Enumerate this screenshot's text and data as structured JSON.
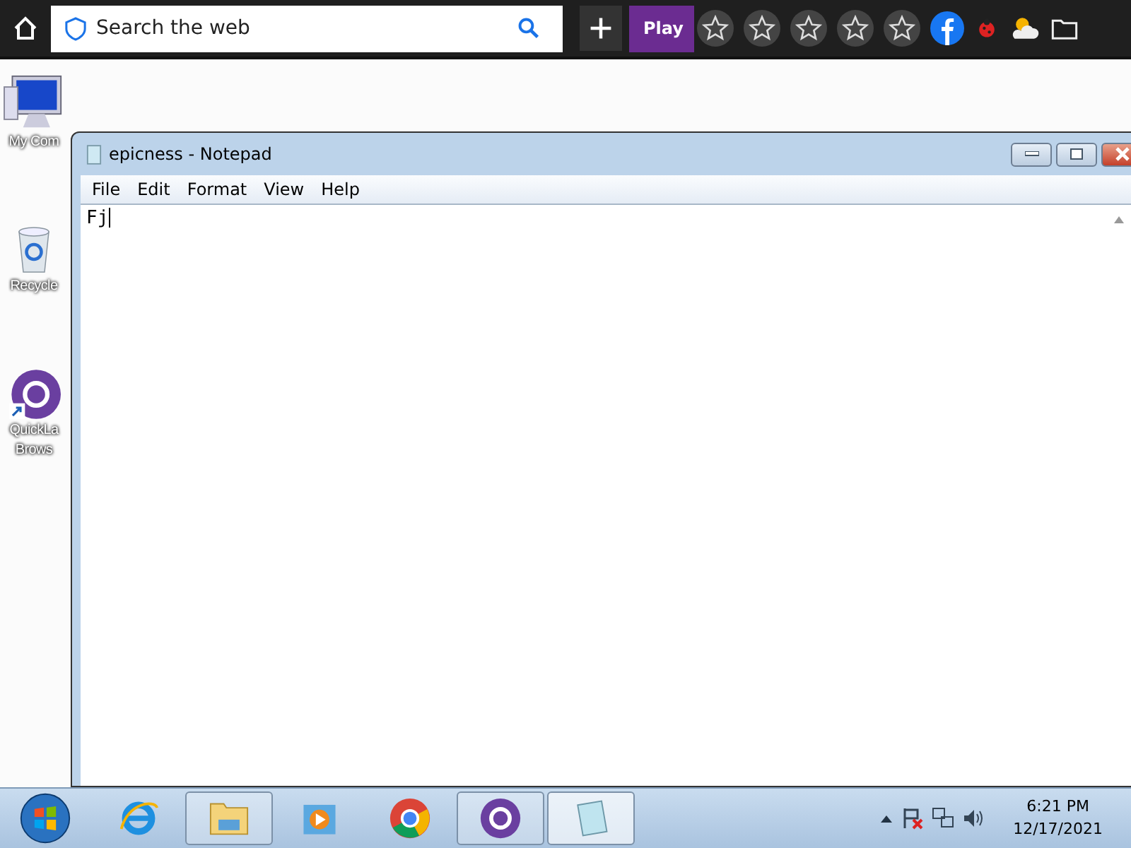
{
  "browser_bar": {
    "search": {
      "placeholder": "Search the web"
    },
    "play_label": "Play",
    "bookmarks": [
      {
        "kind": "star"
      },
      {
        "kind": "star"
      },
      {
        "kind": "star"
      },
      {
        "kind": "star"
      },
      {
        "kind": "star"
      },
      {
        "kind": "facebook"
      },
      {
        "kind": "bug"
      },
      {
        "kind": "weather"
      },
      {
        "kind": "folder"
      }
    ]
  },
  "desktop_icons": [
    {
      "kind": "computer",
      "label": "My Com"
    },
    {
      "kind": "recycle",
      "label": "Recycle"
    },
    {
      "kind": "quicklaunch",
      "label": "QuickLa",
      "label_2": "Brows"
    }
  ],
  "window": {
    "title": "epicness - Notepad",
    "menu": [
      "File",
      "Edit",
      "Format",
      "View",
      "Help"
    ],
    "content": "Fj"
  },
  "taskbar": {
    "items": [
      {
        "kind": "ie",
        "open": false,
        "selected": false
      },
      {
        "kind": "explorer",
        "open": true,
        "selected": false
      },
      {
        "kind": "media",
        "open": false,
        "selected": false
      },
      {
        "kind": "chrome",
        "open": false,
        "selected": false
      },
      {
        "kind": "quicklaunch",
        "open": true,
        "selected": false
      },
      {
        "kind": "notepad",
        "open": true,
        "selected": true
      }
    ],
    "time": "6:21 PM",
    "date": "12/17/2021"
  }
}
